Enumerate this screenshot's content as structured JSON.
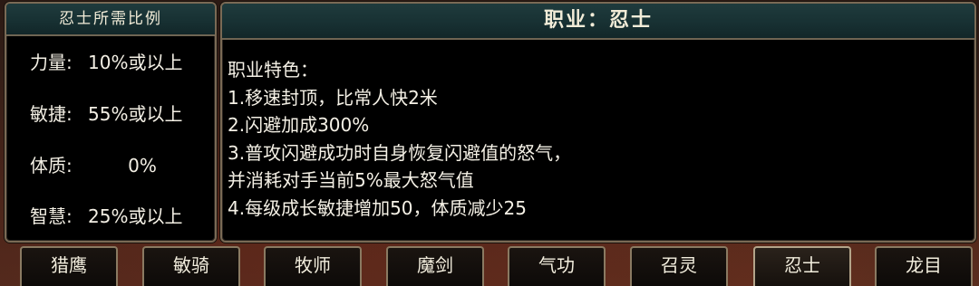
{
  "ratio_panel": {
    "title": "忍士所需比例",
    "stats": [
      {
        "label": "力量:",
        "value": "10%或以上"
      },
      {
        "label": "敏捷:",
        "value": "55%或以上"
      },
      {
        "label": "体质:",
        "value": "0%"
      },
      {
        "label": "智慧:",
        "value": "25%或以上"
      }
    ]
  },
  "class_panel": {
    "title": "职业：忍士",
    "lines": [
      "职业特色：",
      "1.移速封顶，比常人快2米",
      "2.闪避加成300%",
      "3.普攻闪避成功时自身恢复闪避值的怒气，",
      "并消耗对手当前5%最大怒气值",
      "4.每级成长敏捷增加50，体质减少25"
    ]
  },
  "tabs": [
    {
      "label": "猎鹰"
    },
    {
      "label": "敏骑"
    },
    {
      "label": "牧师"
    },
    {
      "label": "魔剑"
    },
    {
      "label": "气功"
    },
    {
      "label": "召灵"
    },
    {
      "label": "忍士",
      "active": true
    },
    {
      "label": "龙目"
    }
  ]
}
